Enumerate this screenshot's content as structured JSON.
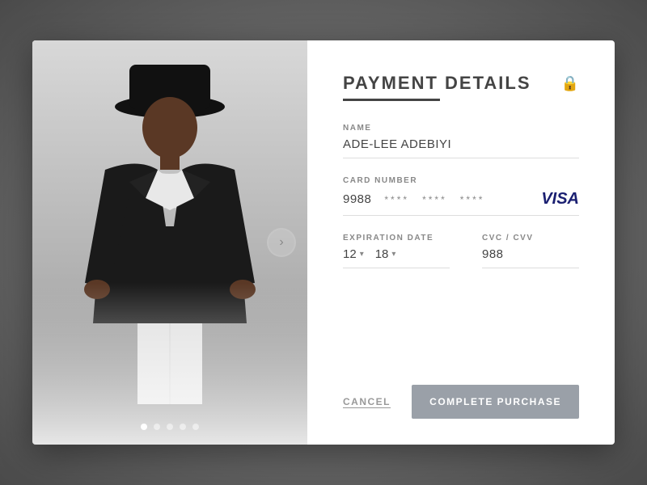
{
  "page": {
    "background_color": "#6a6a6a"
  },
  "header": {
    "title": "PAYMENT DETAILS",
    "lock_icon": "🔒"
  },
  "fields": {
    "name": {
      "label": "NAME",
      "value": "ADE-LEE ADEBIYI"
    },
    "card_number": {
      "label": "CARD NUMBER",
      "first_part": "9988",
      "hidden_parts": [
        "****",
        "****",
        "****"
      ],
      "brand": "VISA"
    },
    "expiration_date": {
      "label": "EXPIRATION DATE",
      "month": "12",
      "year": "18"
    },
    "cvc": {
      "label": "CVC / CVV",
      "value": "988"
    }
  },
  "buttons": {
    "cancel": "CANCEL",
    "complete": "COMPLETE PURCHASE"
  },
  "carousel": {
    "nav_arrow": "›",
    "dots": [
      {
        "active": true
      },
      {
        "active": false
      },
      {
        "active": false
      },
      {
        "active": false
      },
      {
        "active": false
      }
    ]
  }
}
